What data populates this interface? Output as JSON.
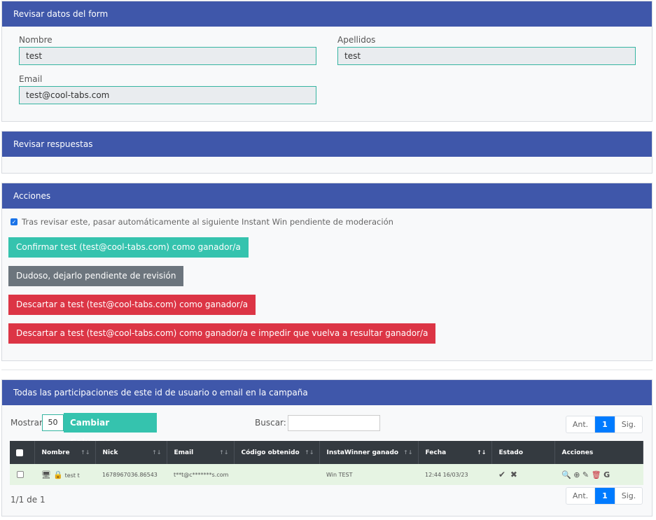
{
  "form_review": {
    "title": "Revisar datos del form",
    "nombre_label": "Nombre",
    "nombre_value": "test",
    "apellidos_label": "Apellidos",
    "apellidos_value": "test",
    "email_label": "Email",
    "email_value": "test@cool-tabs.com"
  },
  "answers_review": {
    "title": "Revisar respuestas"
  },
  "actions": {
    "title": "Acciones",
    "auto_next_label": "Tras revisar este, pasar automáticamente al siguiente Instant Win pendiente de moderación",
    "auto_next_checked": true,
    "confirm_button": "Confirmar test (test@cool-tabs.com) como ganador/a",
    "doubtful_button": "Dudoso, dejarlo pendiente de revisión",
    "discard_button": "Descartar a test (test@cool-tabs.com) como ganador/a",
    "discard_block_button": "Descartar a test (test@cool-tabs.com) como ganador/a e impedir que vuelva a resultar ganador/a"
  },
  "participations": {
    "title": "Todas las participaciones de este id de usuario o email en la campaña",
    "show_label": "Mostrar",
    "show_value": "50",
    "columns_button": "Cambiar Columnas",
    "search_label": "Buscar:",
    "search_value": "",
    "pager": {
      "prev": "Ant.",
      "current": "1",
      "next": "Sig."
    },
    "columns": [
      "Nombre",
      "Nick",
      "Email",
      "Código obtenido",
      "InstaWinner ganado",
      "Fecha",
      "Estado",
      "Acciones"
    ],
    "rows": [
      {
        "nombre": "test t",
        "nick": "1678967036.86543",
        "email": "t**t@c*******s.com",
        "codigo": "",
        "ganado": "Win TEST",
        "fecha": "12:44 16/03/23"
      }
    ],
    "count_text": "1/1 de 1",
    "colors": {
      "header": "#3f57aa",
      "teal": "#35c3ae",
      "red": "#dc3545",
      "row": "#e6f4e3"
    }
  }
}
